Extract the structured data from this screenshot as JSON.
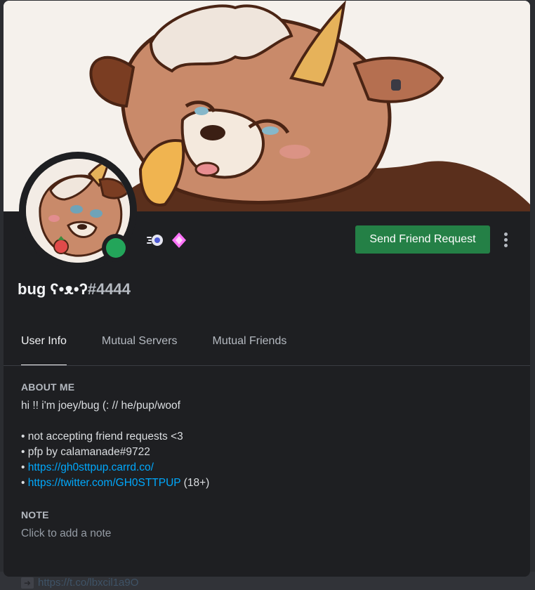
{
  "background": {
    "link_text": "https://t.co/lbxcil1a9O"
  },
  "profile": {
    "username": "bug ʕ•ᴥ•ʔ",
    "discriminator": "#4444",
    "status_color": "#23a55a",
    "badges": [
      "nitro-icon",
      "boost-icon"
    ]
  },
  "actions": {
    "send_friend_request": "Send Friend Request"
  },
  "tabs": [
    {
      "label": "User Info",
      "active": true
    },
    {
      "label": "Mutual Servers",
      "active": false
    },
    {
      "label": "Mutual Friends",
      "active": false
    }
  ],
  "about": {
    "title": "ABOUT ME",
    "line1": "hi !! i'm joey/bug (:  // he/pup/woof",
    "bullet1": "• not accepting friend requests <3",
    "bullet2": "• pfp by calamanade#9722",
    "bullet3_prefix": "• ",
    "link1": "https://gh0sttpup.carrd.co/",
    "bullet4_prefix": "• ",
    "link2": "https://twitter.com/GH0STTPUP",
    "link2_suffix": " (18+)"
  },
  "note": {
    "title": "NOTE",
    "placeholder": "Click to add a note"
  },
  "colors": {
    "accent_button": "#248046",
    "link": "#00a8fc",
    "modal_bg": "#1e1f22"
  }
}
